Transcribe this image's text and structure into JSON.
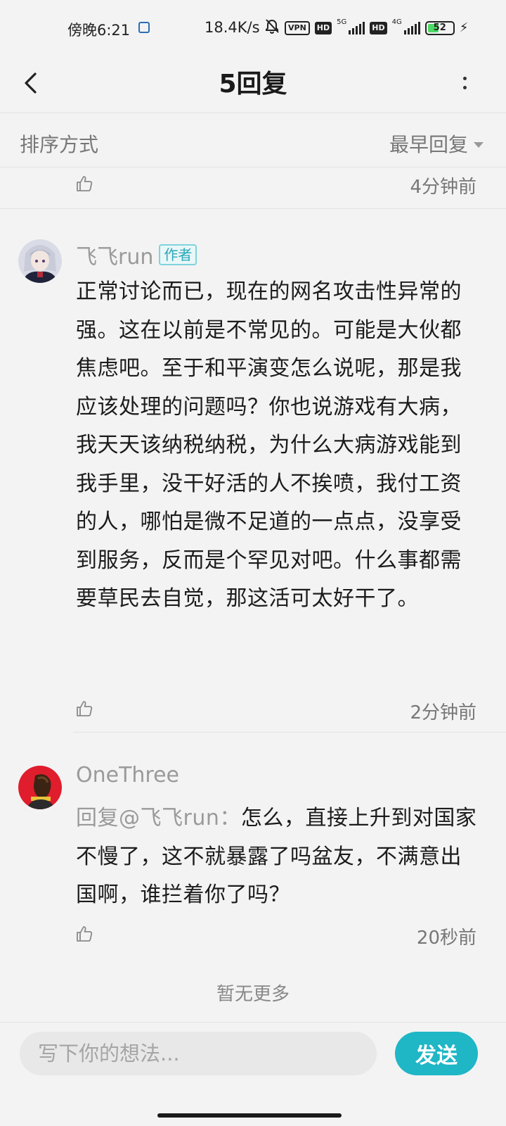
{
  "status_bar": {
    "time": "傍晚6:21",
    "net_speed": "18.4K/s",
    "vpn": "VPN",
    "hd": "HD",
    "net_5g": "5G",
    "net_4g": "4G",
    "battery": "52",
    "battery_level": 0.52
  },
  "header": {
    "title": "5回复",
    "back_icon": "chevron-left-icon",
    "more_icon": "more-vertical-icon"
  },
  "sort": {
    "label": "排序方式",
    "value": "最早回复"
  },
  "prev_comment": {
    "time": "4分钟前"
  },
  "comments": [
    {
      "username": "飞飞run",
      "tag": "作者",
      "text": "正常讨论而已，现在的网名攻击性异常的强。这在以前是不常见的。可能是大伙都焦虑吧。至于和平演变怎么说呢，那是我应该处理的问题吗？你也说游戏有大病，我天天该纳税纳税，为什么大病游戏能到我手里，没干好活的人不挨喷，我付工资的人，哪怕是微不足道的一点点，没享受到服务，反而是个罕见对吧。什么事都需要草民去自觉，那这活可太好干了。",
      "time": "2分钟前"
    },
    {
      "username": "OneThree",
      "reply_prefix": "回复@飞飞run：",
      "text": "怎么，直接上升到对国家不慢了，这不就暴露了吗盆友，不满意出国啊，谁拦着你了吗？",
      "time": "20秒前"
    }
  ],
  "footer": {
    "no_more": "暂无更多",
    "input_placeholder": "写下你的想法...",
    "send_label": "发送"
  },
  "colors": {
    "accent": "#1fb6c6",
    "author_tag": "#29a7b8",
    "background": "#f3f3f3"
  }
}
